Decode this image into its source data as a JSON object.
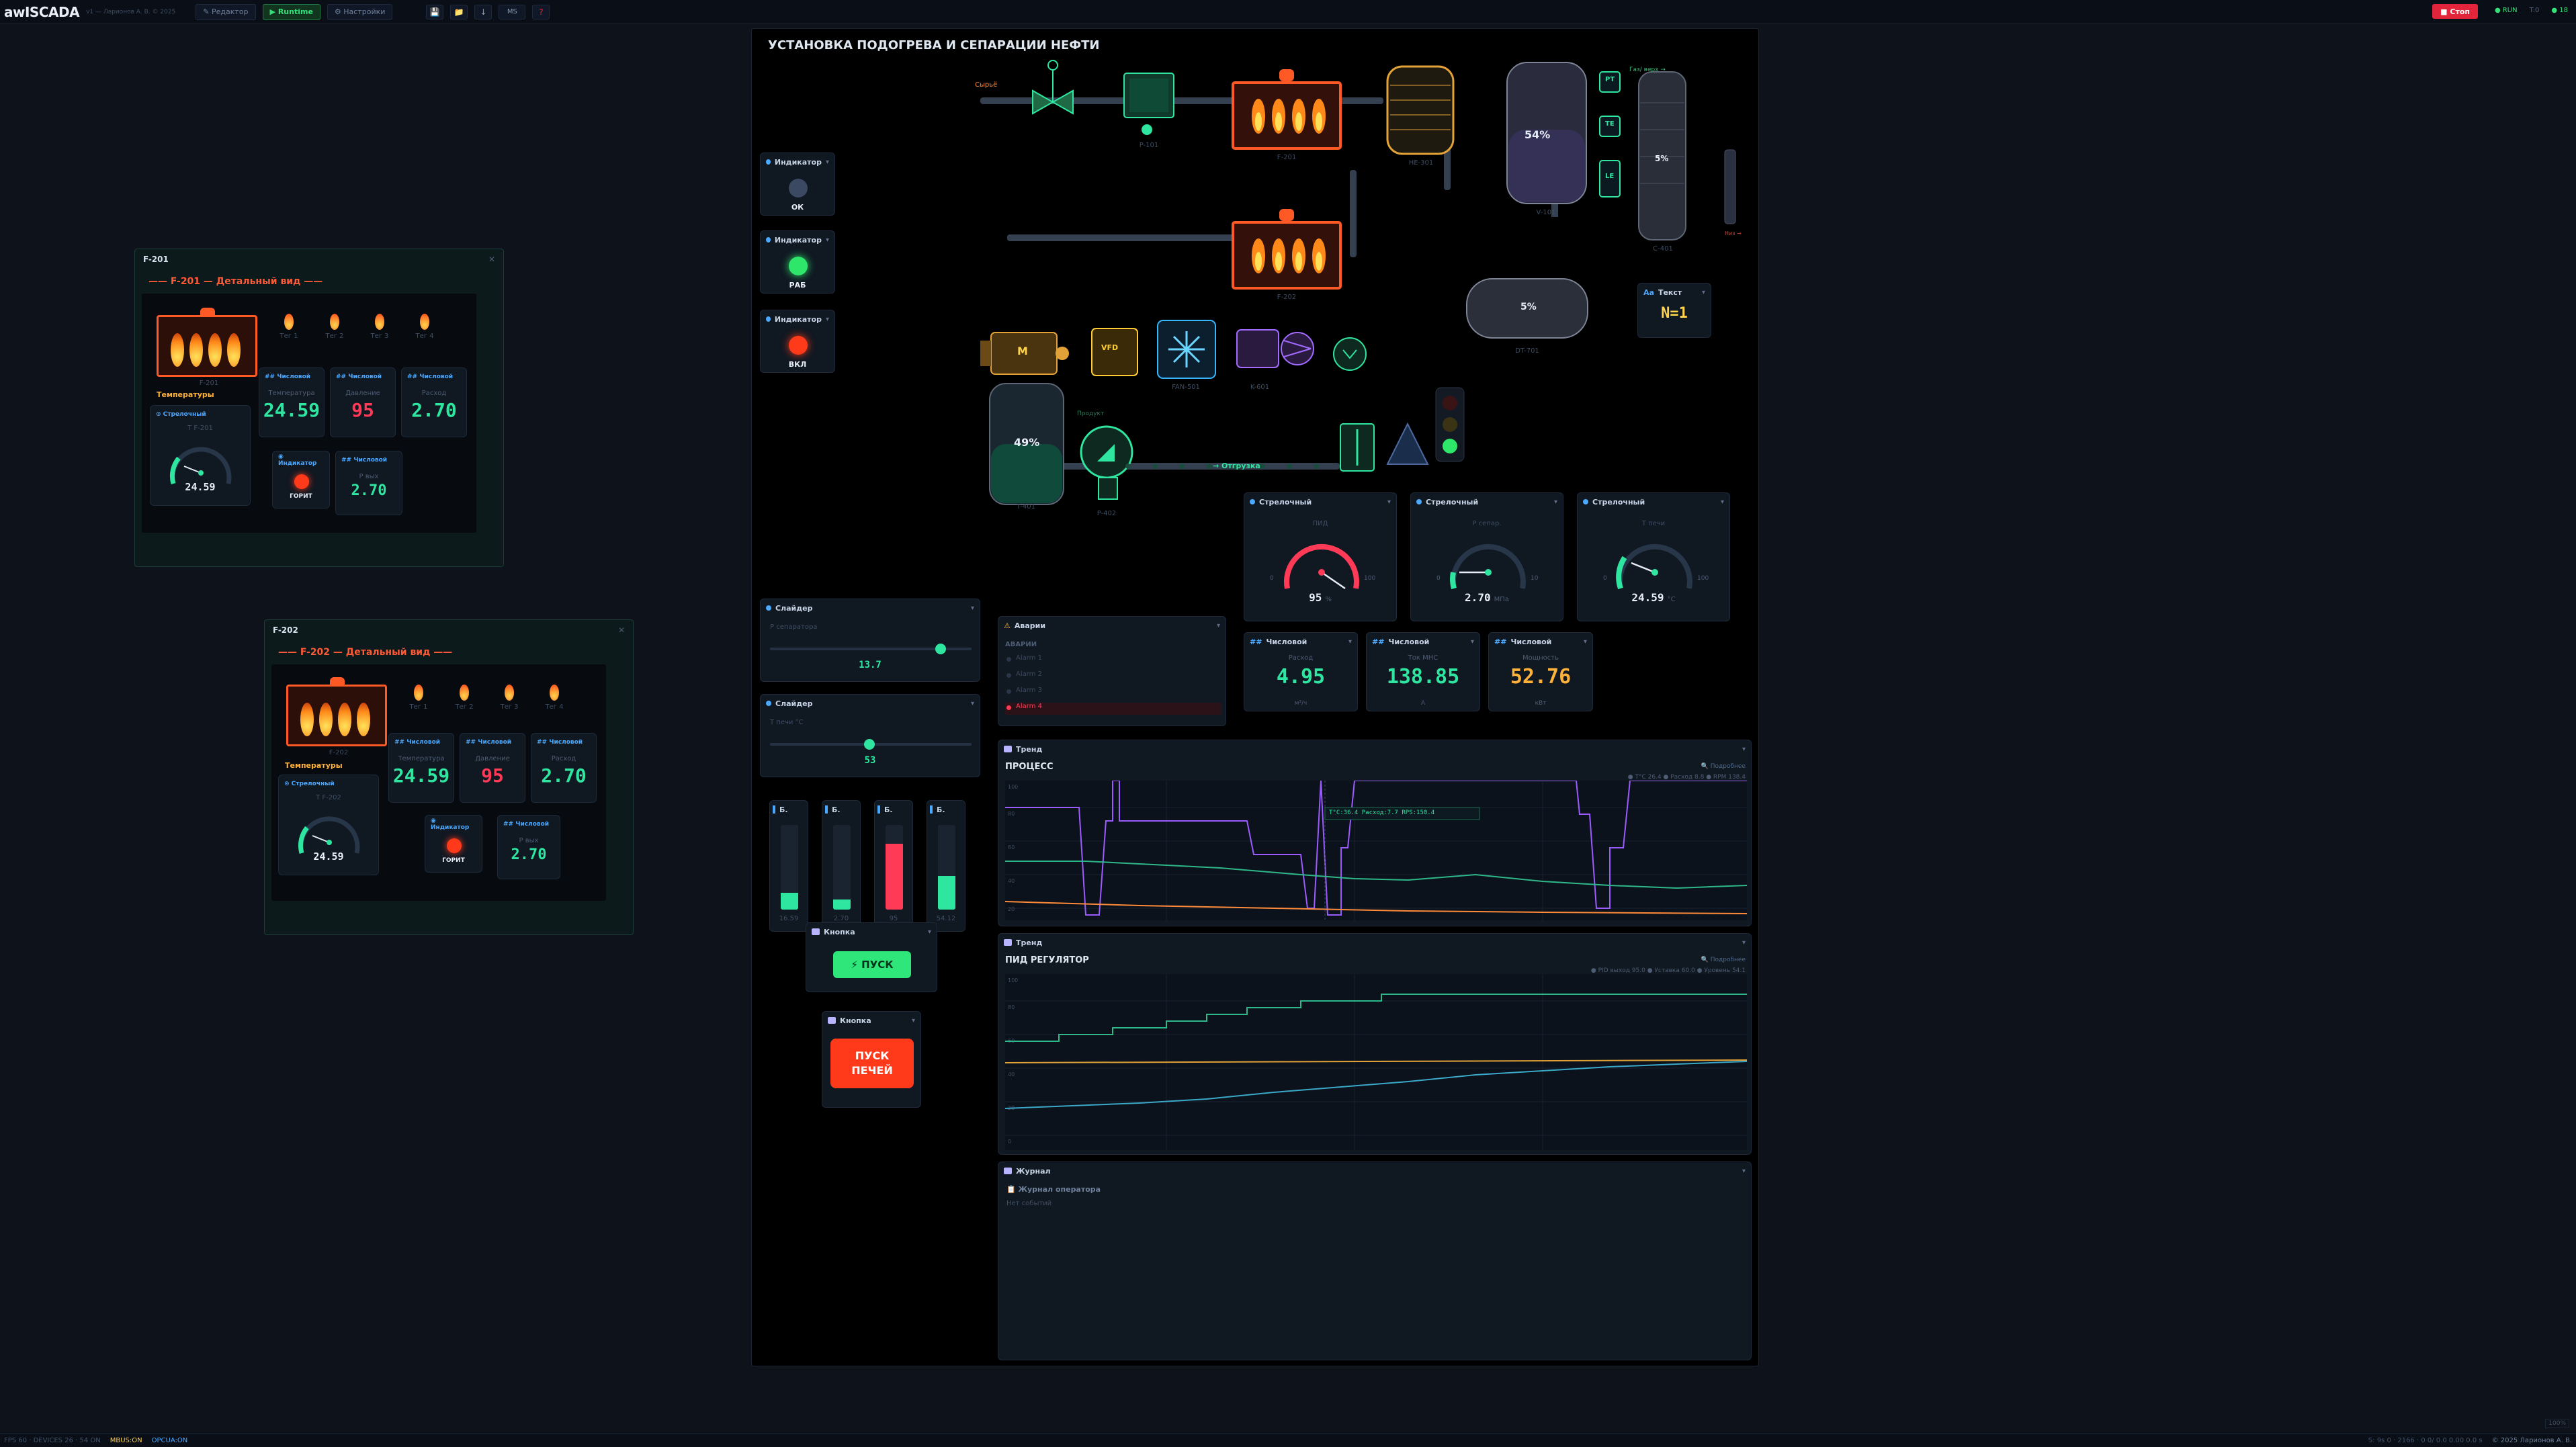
{
  "topbar": {
    "app": "awISCADA",
    "subtitle": "v1 — Ларионов А. В. © 2025",
    "editor": "✎ Редактор",
    "runtime": "▶ Runtime",
    "settings": "⚙ Настройки",
    "ms": "МS",
    "help": "?",
    "stop": "■ Стоп",
    "run": "● RUN",
    "t1": "T:0",
    "t2": "● 18"
  },
  "status": {
    "fps": "FPS 60 · DEVICES 26 · 54 ON",
    "modbus": "MBUS:ON",
    "opcua": "OPCUA:ON",
    "right": "S: 9s 0 · 2166 · 0 0/ 0.0 0.00 0.0 s",
    "copy": "© 2025 Ларионов А. В.",
    "zoom": "100%"
  },
  "win1": {
    "title": "F-201",
    "head": "—— F-201 — Детальный вид ——"
  },
  "win2": {
    "title": "F-202",
    "head": "—— F-202 — Детальный вид ——"
  },
  "winsub": {
    "temps": "Температуры",
    "tags": [
      "Тег 1",
      "Тег 2",
      "Тег 3",
      "Тег 4"
    ],
    "num": "## Числовой",
    "arrow": "⊙ Стрелочный",
    "indic": "◉ Индикатор",
    "lamp": "ГОРИТ"
  },
  "win1v": {
    "f": "F-201",
    "v1": "24.59",
    "l1": "Температура",
    "v2": "95",
    "l2": "Давление",
    "v3": "2.70",
    "l3": "Расход",
    "g": "24.59",
    "gl": "T F-201",
    "p": "2.70",
    "pl": "P вых"
  },
  "win2v": {
    "f": "F-202",
    "v1": "24.59",
    "l1": "Температура",
    "v2": "95",
    "l2": "Давление",
    "v3": "2.70",
    "l3": "Расход",
    "g": "24.59",
    "gl": "T F-202",
    "p": "2.70",
    "pl": "P вых"
  },
  "canvas": {
    "title": "УСТАНОВКА ПОДОГРЕВА И СЕПАРАЦИИ НЕФТИ"
  },
  "proc": {
    "raw": "Сырьё",
    "p101": "P-101",
    "f201": "F-201",
    "f202": "F-202",
    "he": "HE-301",
    "v101": "V-101",
    "c401": "C-401",
    "dt": "DT-701",
    "m": "M",
    "vfd": "VFD",
    "fan": "FAN-501",
    "k601": "K-601",
    "t401": "T-401",
    "p402": "P-402",
    "pt": "PT",
    "te": "TE",
    "le": "LE",
    "p54": "54%",
    "p5": "5%",
    "dt5": "5%",
    "t49": "49%",
    "ship": "→ Отгрузка",
    "prod": "Продукт",
    "top": "Газ/ верх →",
    "bot": "Низ →"
  },
  "indicators": [
    {
      "h": "Индикатор",
      "t": "ОК"
    },
    {
      "h": "Индикатор",
      "t": "РАБ"
    },
    {
      "h": "Индикатор",
      "t": "ВКЛ"
    }
  ],
  "text_w": {
    "h": "Текст",
    "v": "N=1"
  },
  "gauges": [
    {
      "h": "Стрелочный",
      "l": "ПИД",
      "v": "95",
      "u": "%",
      "min": "0",
      "max": "100"
    },
    {
      "h": "Стрелочный",
      "l": "P сепар.",
      "v": "2.70",
      "u": "МПа",
      "min": "0",
      "max": "10"
    },
    {
      "h": "Стрелочный",
      "l": "T печи",
      "v": "24.59",
      "u": "°C",
      "min": "0",
      "max": "100"
    }
  ],
  "nums": [
    {
      "h": "Числовой",
      "l": "Расход",
      "v": "4.95",
      "u": "м³/ч"
    },
    {
      "h": "Числовой",
      "l": "Ток МНС",
      "v": "138.85",
      "u": "А"
    },
    {
      "h": "Числовой",
      "l": "Мощность",
      "v": "52.76",
      "u": "кВт"
    }
  ],
  "sliders": [
    {
      "h": "Слайдер",
      "l": "P сепаратора",
      "v": "13.7"
    },
    {
      "h": "Слайдер",
      "l": "T печи °C",
      "v": "53"
    }
  ],
  "alarms": {
    "h": "Аварии",
    "sub": "АВАРИИ",
    "items": [
      "Alarm 1",
      "Alarm 2",
      "Alarm 3",
      "Alarm 4"
    ]
  },
  "bars": [
    {
      "h": "Б.",
      "v": "16.59"
    },
    {
      "h": "Б.",
      "v": "2.70"
    },
    {
      "h": "Б.",
      "v": "95"
    },
    {
      "h": "Б.",
      "v": "54.12"
    }
  ],
  "btn1": {
    "h": "Кнопка",
    "t": "⚡ ПУСК"
  },
  "btn2": {
    "h": "Кнопка",
    "t1": "ПУСК",
    "t2": "ПЕЧЕЙ"
  },
  "trend1": {
    "h": "Тренд",
    "title": "ПРОЦЕСС",
    "link": "🔍 Подробнее",
    "legend": "● T°C 26.4 ● Расход 8.8 ● RPM 138.4",
    "tooltip": "T°C:36.4 Расход:7.7 RPS:150.4",
    "y": [
      "100",
      "80",
      "60",
      "40",
      "20"
    ]
  },
  "trend2": {
    "h": "Тренд",
    "title": "ПИД РЕГУЛЯТОР",
    "link": "🔍 Подробнее",
    "legend": "● PID выход 95.0 ● Уставка 60.0 ● Уровень 54.1",
    "y": [
      "100",
      "80",
      "60",
      "40",
      "20",
      "0"
    ]
  },
  "journal": {
    "h": "Журнал",
    "title": "📋 Журнал оператора",
    "empty": "Нет событий"
  }
}
